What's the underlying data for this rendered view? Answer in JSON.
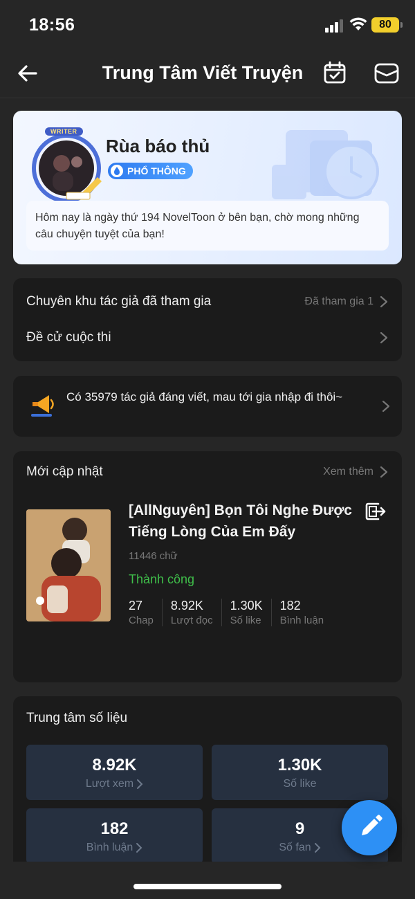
{
  "status_bar": {
    "time": "18:56",
    "battery": "80"
  },
  "nav": {
    "title": "Trung Tâm Viết Truyện"
  },
  "profile": {
    "avatar_badge": "WRITER",
    "username": "Rùa báo thủ",
    "tier": "PHỔ THÔNG",
    "greeting": "Hôm nay là ngày thứ 194 NovelToon ở bên bạn, chờ mong những câu chuyện tuyệt của bạn!"
  },
  "menu": {
    "joined_zones_label": "Chuyên khu tác giả đã tham gia",
    "joined_zones_value": "Đã tham gia 1",
    "contest_label": "Đề cử cuộc thi"
  },
  "promo": {
    "text": "Có 35979 tác giả đáng viết, mau tới gia nhập đi thôi~"
  },
  "latest": {
    "header": "Mới cập nhật",
    "see_more": "Xem thêm",
    "book": {
      "title": "[AllNguyên] Bọn Tôi Nghe Được Tiếng Lòng Của Em Đấy",
      "word_count": "11446 chữ",
      "status": "Thành công",
      "stats": [
        {
          "value": "27",
          "label": "Chap"
        },
        {
          "value": "8.92K",
          "label": "Lượt đọc"
        },
        {
          "value": "1.30K",
          "label": "Số like"
        },
        {
          "value": "182",
          "label": "Bình luận"
        }
      ]
    }
  },
  "data_center": {
    "header": "Trung tâm số liệu",
    "tiles": [
      {
        "value": "8.92K",
        "label": "Lượt xem"
      },
      {
        "value": "1.30K",
        "label": "Số like"
      },
      {
        "value": "182",
        "label": "Bình luận"
      },
      {
        "value": "9",
        "label": "Số fan"
      }
    ]
  },
  "colors": {
    "accent": "#2d90f5",
    "success": "#3fbf4a",
    "battery": "#f2cf2c"
  }
}
